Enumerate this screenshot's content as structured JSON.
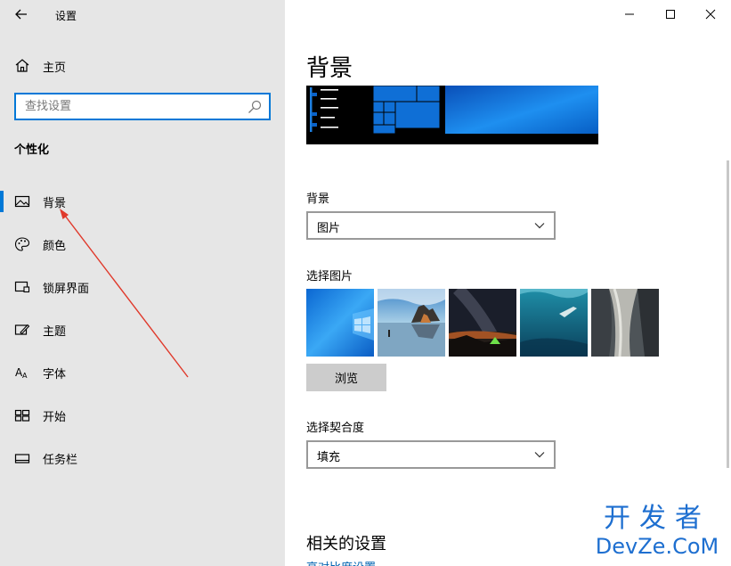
{
  "window": {
    "title": "设置",
    "minimize": "—",
    "maximize": "☐",
    "close": "✕"
  },
  "sidebar": {
    "home_label": "主页",
    "search_placeholder": "查找设置",
    "section_title": "个性化",
    "items": [
      {
        "label": "背景",
        "icon": "picture-icon",
        "active": true
      },
      {
        "label": "颜色",
        "icon": "palette-icon",
        "active": false
      },
      {
        "label": "锁屏界面",
        "icon": "lock-screen-icon",
        "active": false
      },
      {
        "label": "主题",
        "icon": "theme-icon",
        "active": false
      },
      {
        "label": "字体",
        "icon": "font-icon",
        "active": false
      },
      {
        "label": "开始",
        "icon": "start-icon",
        "active": false
      },
      {
        "label": "任务栏",
        "icon": "taskbar-icon",
        "active": false
      }
    ]
  },
  "main": {
    "page_title": "背景",
    "background_label": "背景",
    "background_value": "图片",
    "pick_label": "选择图片",
    "browse_label": "浏览",
    "fit_label": "选择契合度",
    "fit_value": "填充",
    "related_title": "相关的设置",
    "related_link": "高对比度设置"
  },
  "colors": {
    "accent": "#0078d7",
    "sidebar_bg": "#e6e6e6",
    "arrow": "#e0392b",
    "watermark": "#1e6fd0"
  },
  "watermark": {
    "line1": "开发者",
    "line2": "DevZe.CoM"
  }
}
